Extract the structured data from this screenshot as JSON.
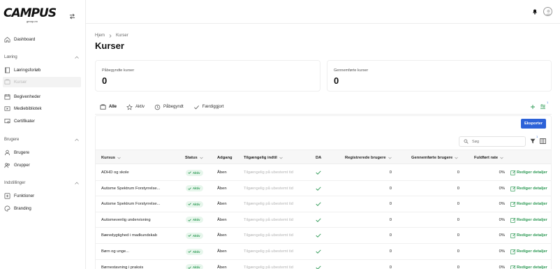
{
  "app": {
    "logo_main": "CAMPUS",
    "logo_sub": "group.no"
  },
  "sidebar": {
    "dashboard": "Dashboard",
    "section_learning": "Læring",
    "learning_paths": "Læringsforløb",
    "courses": "Kurser",
    "events": "Begivenheder",
    "media_library": "Mediebibliotek",
    "certificates": "Certifikater",
    "section_users": "Brugere",
    "users": "Brugere",
    "groups": "Grupper",
    "section_settings": "Indstillinger",
    "functions": "Funktioner",
    "branding": "Branding"
  },
  "breadcrumb": {
    "home": "Hjem",
    "current": "Kurser"
  },
  "page_title": "Kurser",
  "stats": {
    "started_label": "Påbegyndte kurser",
    "started_value": "0",
    "completed_label": "Gennemførte kurser",
    "completed_value": "0"
  },
  "tabs": {
    "all": "Alle",
    "active": "Aktiv",
    "started": "Påbegyndt",
    "completed": "Færdiggjort",
    "filter_badge": "1"
  },
  "toolbar": {
    "export_label": "Eksporter",
    "search_placeholder": "Søg",
    "filter_badge": "1"
  },
  "table": {
    "headers": {
      "course": "Kursus",
      "status": "Status",
      "access": "Adgang",
      "available_until": "Tilgængelig indtil",
      "da": "DA",
      "registered": "Registrerede brugere",
      "completed": "Gennemførte brugere",
      "completion": "Fuldført rate"
    },
    "rows": [
      {
        "course": "ADHD og skole",
        "status": "Aktiv",
        "access": "Åben",
        "available": "Tilgængelig på ubestemt tid",
        "registered": "0",
        "completed": "0",
        "rate": "0%",
        "action": "Rediger detaljer"
      },
      {
        "course": "Autisme Spektrum Forstyrrelse...",
        "status": "Aktiv",
        "access": "Åben",
        "available": "Tilgængelig på ubestemt tid",
        "registered": "0",
        "completed": "0",
        "rate": "0%",
        "action": "Rediger detaljer"
      },
      {
        "course": "Autisme Spektrum Forstyrrelse...",
        "status": "Aktiv",
        "access": "Åben",
        "available": "Tilgængelig på ubestemt tid",
        "registered": "0",
        "completed": "0",
        "rate": "0%",
        "action": "Rediger detaljer"
      },
      {
        "course": "Autismevenlig undervisning",
        "status": "Aktiv",
        "access": "Åben",
        "available": "Tilgængelig på ubestemt tid",
        "registered": "0",
        "completed": "0",
        "rate": "0%",
        "action": "Rediger detaljer"
      },
      {
        "course": "Bæredygtighed i madkundskab",
        "status": "Aktiv",
        "access": "Åben",
        "available": "Tilgængelig på ubestemt tid",
        "registered": "0",
        "completed": "0",
        "rate": "0%",
        "action": "Rediger detaljer"
      },
      {
        "course": "Børn og unge...",
        "status": "Aktiv",
        "access": "Åben",
        "available": "Tilgængelig på ubestemt tid",
        "registered": "0",
        "completed": "0",
        "rate": "0%",
        "action": "Rediger detaljer"
      },
      {
        "course": "Børnestavning i praksis",
        "status": "Aktiv",
        "access": "Åben",
        "available": "Tilgængelig på ubestemt tid",
        "registered": "0",
        "completed": "0",
        "rate": "0%",
        "action": "Rediger detaljer"
      }
    ]
  },
  "colors": {
    "accent": "#2d62d8",
    "success": "#2e9a55",
    "success_bg": "#e7f6ec"
  }
}
